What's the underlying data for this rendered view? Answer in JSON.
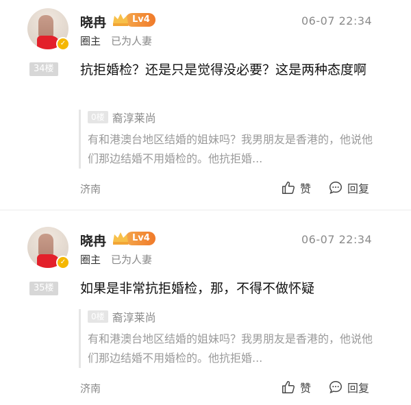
{
  "posts": [
    {
      "username": "晓冉",
      "level": "Lv4",
      "role": "圈主",
      "role_desc": "已为人妻",
      "time": "06-07 22:34",
      "floor": "34楼",
      "content": "抗拒婚检？还是只是觉得没必要？这是两种态度啊",
      "quote": {
        "floor": "0楼",
        "name": "裔淳莱尚",
        "text": "有和港澳台地区结婚的姐妹吗？我男朋友是香港的，他说他们那边结婚不用婚检的。他抗拒婚..."
      },
      "location": "济南",
      "like_label": "赞",
      "reply_label": "回复"
    },
    {
      "username": "晓冉",
      "level": "Lv4",
      "role": "圈主",
      "role_desc": "已为人妻",
      "time": "06-07 22:34",
      "floor": "35楼",
      "content": "如果是非常抗拒婚检，那，不得不做怀疑",
      "quote": {
        "floor": "0楼",
        "name": "裔淳莱尚",
        "text": "有和港澳台地区结婚的姐妹吗？我男朋友是香港的，他说他们那边结婚不用婚检的。他抗拒婚..."
      },
      "location": "济南",
      "like_label": "赞",
      "reply_label": "回复"
    }
  ],
  "icons": {
    "verify": "verified-badge-icon",
    "crown": "crown-icon",
    "like": "thumbs-up-icon",
    "reply": "comment-bubble-icon"
  },
  "colors": {
    "level_badge": "#f07a2a",
    "verify": "#f5b700"
  }
}
